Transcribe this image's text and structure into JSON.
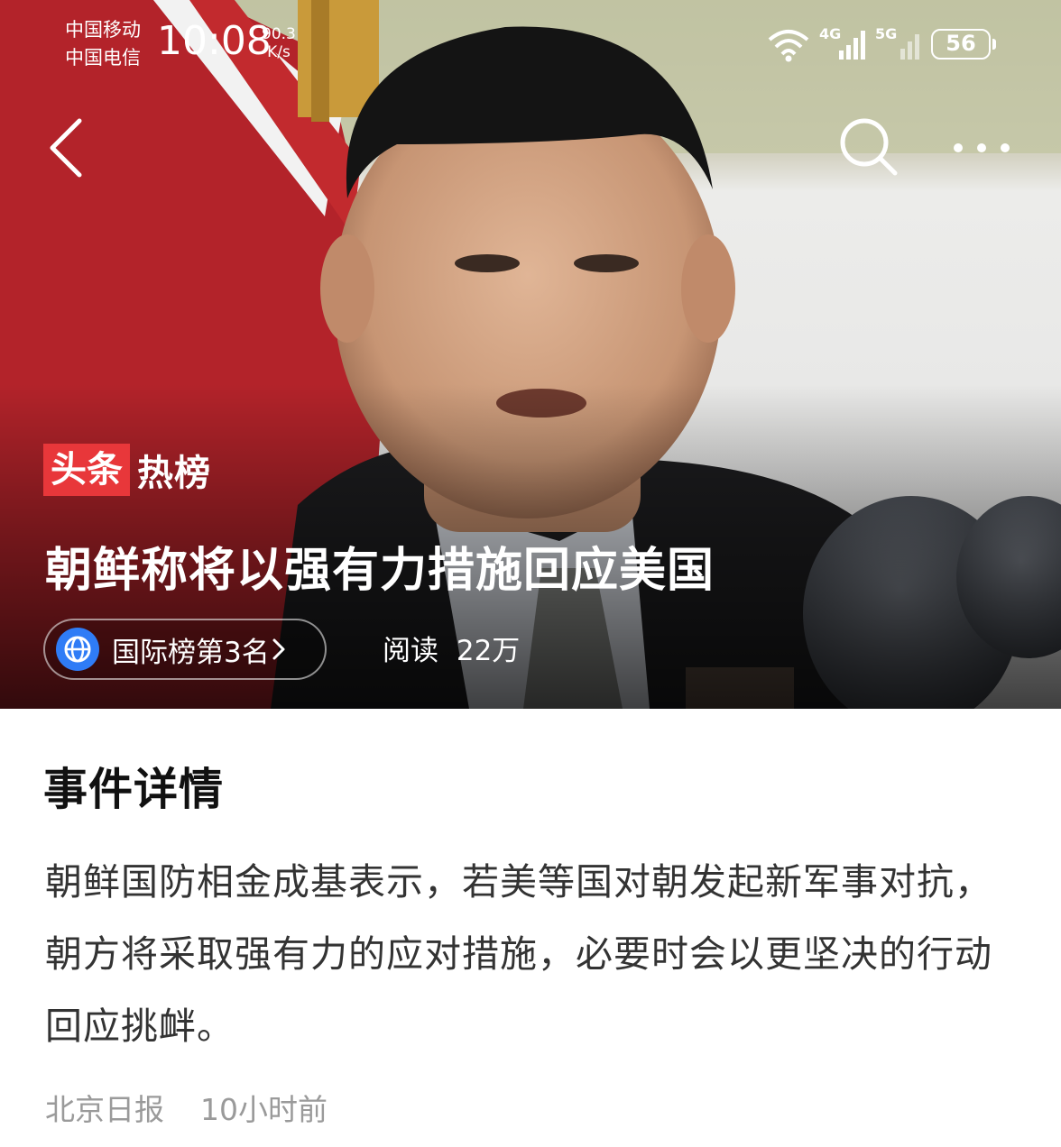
{
  "status_bar": {
    "carrier_1": "中国移动",
    "carrier_2": "中国电信",
    "time": "10:08",
    "net_speed_value": "90.3",
    "net_speed_unit": "K/s",
    "network_1": "4G",
    "network_2": "5G",
    "battery": "56",
    "icons": [
      "wifi-icon",
      "signal-4g-icon",
      "signal-5g-icon",
      "battery-icon"
    ]
  },
  "nav": {
    "icons": [
      "back-arrow-icon",
      "search-icon",
      "more-dots-icon"
    ]
  },
  "hero": {
    "badge_red": "头条",
    "badge_white": "热榜",
    "headline": "朝鲜称将以强有力措施回应美国",
    "rank_label": "国际榜第3名",
    "rank_icon": "globe-icon",
    "reads_label": "阅读",
    "reads_value": "22万",
    "colors": {
      "badge_red": "#e8373a",
      "globe_blue": "#2f7cf6"
    }
  },
  "details": {
    "title": "事件详情",
    "summary": "朝鲜国防相金成基表示，若美等国对朝发起新军事对抗，朝方将采取强有力的应对措施，必要时会以更坚决的行动回应挑衅。",
    "source": "北京日报",
    "time_ago": "10小时前"
  }
}
